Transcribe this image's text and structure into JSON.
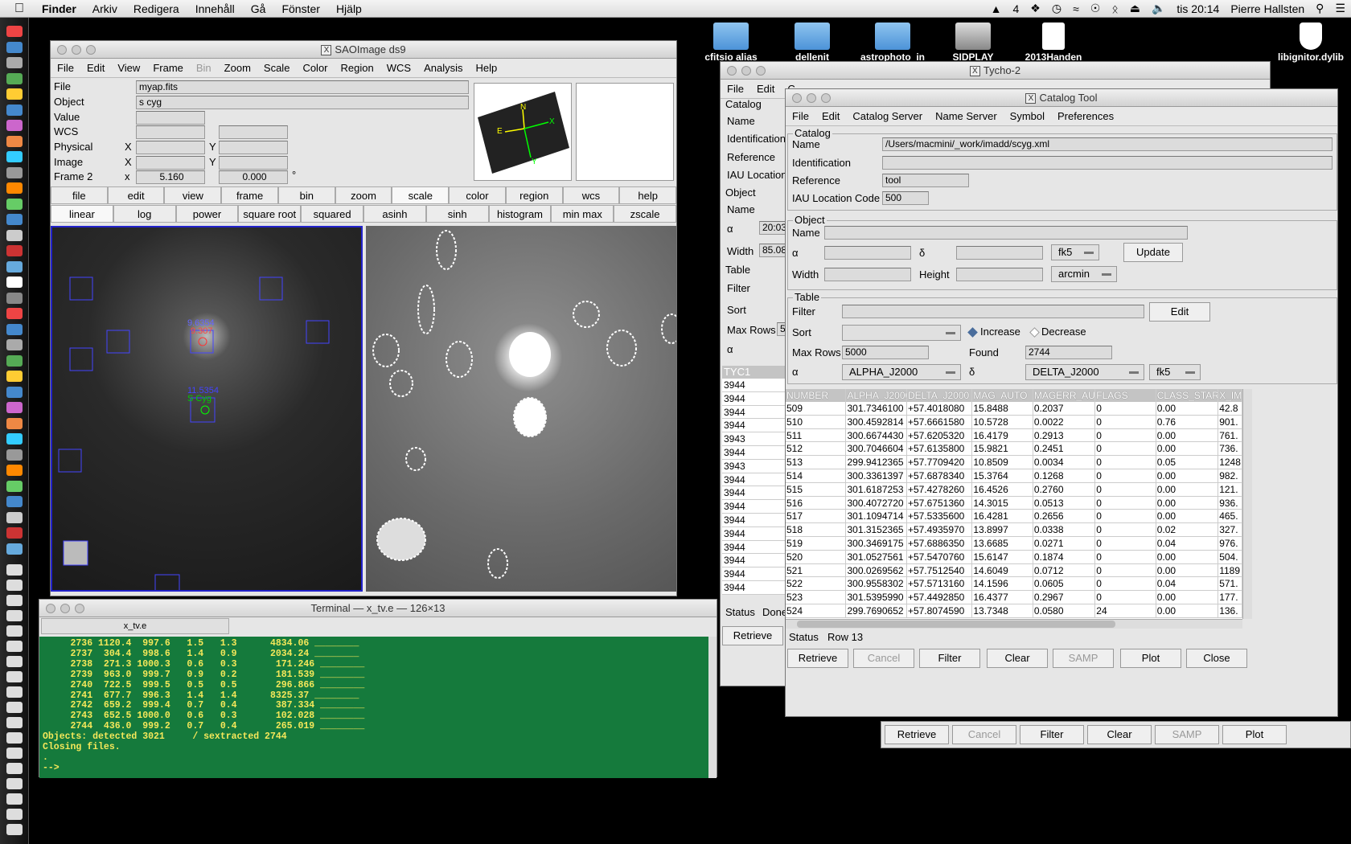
{
  "menubar": {
    "app": "Finder",
    "items": [
      "Arkiv",
      "Redigera",
      "Innehåll",
      "Gå",
      "Fönster",
      "Hjälp"
    ],
    "status": [
      "4",
      "tis 20:14",
      "Pierre Hallsten"
    ]
  },
  "desktop": {
    "icons": [
      "cfitsio alias",
      "dellenit",
      "astrophoto_in",
      "SIDPLAY",
      "2013Handen",
      "libignitor.dylib"
    ]
  },
  "ds9": {
    "title": "SAOImage ds9",
    "menu": [
      "File",
      "Edit",
      "View",
      "Frame",
      "Bin",
      "Zoom",
      "Scale",
      "Color",
      "Region",
      "WCS",
      "Analysis",
      "Help"
    ],
    "info_labels": [
      "File",
      "Object",
      "Value",
      "WCS",
      "Physical",
      "Image",
      "Frame 2"
    ],
    "file": "myap.fits",
    "object": "s cyg",
    "frame_x": "5.160",
    "frame_y": "0.000",
    "deg": "°",
    "x_label": "X",
    "y_label": "Y",
    "x_lower": "x",
    "buttons": [
      "file",
      "edit",
      "view",
      "frame",
      "bin",
      "zoom",
      "scale",
      "color",
      "region",
      "wcs",
      "help"
    ],
    "scale_buttons": [
      "linear",
      "log",
      "power",
      "square root",
      "squared",
      "asinh",
      "sinh",
      "histogram",
      "min max",
      "zscale"
    ],
    "compass": {
      "n": "N",
      "e": "E",
      "x": "X",
      "y": "Y"
    },
    "labels": {
      "a": "9.6354",
      "b": "9.307",
      "c": "11.5354",
      "d": "S Cyg"
    }
  },
  "tycho": {
    "title": "Tycho-2",
    "menu": [
      "File",
      "Edit",
      "C"
    ],
    "labels": [
      "Catalog",
      "Name",
      "Identification",
      "Reference",
      "IAU Location",
      "Object",
      "Name",
      "Width",
      "Table",
      "Filter",
      "Sort",
      "Max Rows"
    ],
    "alpha": "α",
    "alpha_val": "20:03",
    "width_val": "85.08",
    "maxrows_val": "5",
    "col": "TYC1",
    "rows": [
      "3944",
      "3944",
      "3944",
      "3944",
      "3943",
      "3944",
      "3943",
      "3944",
      "3944",
      "3944",
      "3944",
      "3944",
      "3944",
      "3944",
      "3944",
      "3944"
    ],
    "status_label": "Status",
    "status_val": "Done",
    "retrieve": "Retrieve"
  },
  "catalog": {
    "title": "Catalog Tool",
    "menu": [
      "File",
      "Edit",
      "Catalog Server",
      "Name Server",
      "Symbol",
      "Preferences"
    ],
    "catalog_section": "Catalog",
    "name_label": "Name",
    "name_val": "/Users/macmini/_work/imadd/scyg.xml",
    "ident_label": "Identification",
    "ref_label": "Reference",
    "ref_val": "tool",
    "iau_label": "IAU Location Code",
    "iau_val": "500",
    "object_section": "Object",
    "obj_name_label": "Name",
    "alpha": "α",
    "delta": "δ",
    "system": "fk5",
    "update": "Update",
    "width_label": "Width",
    "height_label": "Height",
    "unit": "arcmin",
    "table_section": "Table",
    "filter_label": "Filter",
    "edit": "Edit",
    "sort_label": "Sort",
    "increase": "Increase",
    "decrease": "Decrease",
    "maxrows_label": "Max Rows",
    "maxrows_val": "5000",
    "found_label": "Found",
    "found_val": "2744",
    "alpha_col": "ALPHA_J2000",
    "delta_col": "DELTA_J2000",
    "sys2": "fk5",
    "columns": [
      "NUMBER",
      "ALPHA_J2000",
      "DELTA_J2000",
      "MAG_AUTO",
      "MAGERR_AUTO",
      "FLAGS",
      "CLASS_STAR",
      "X_IM"
    ],
    "rows": [
      [
        "509",
        "301.7346100",
        "+57.4018080",
        "15.8488",
        "0.2037",
        "0",
        "0.00",
        "42.8"
      ],
      [
        "510",
        "300.4592814",
        "+57.6661580",
        "10.5728",
        "0.0022",
        "0",
        "0.76",
        "901."
      ],
      [
        "511",
        "300.6674430",
        "+57.6205320",
        "16.4179",
        "0.2913",
        "0",
        "0.00",
        "761."
      ],
      [
        "512",
        "300.7046604",
        "+57.6135800",
        "15.9821",
        "0.2451",
        "0",
        "0.00",
        "736."
      ],
      [
        "513",
        "299.9412365",
        "+57.7709420",
        "10.8509",
        "0.0034",
        "0",
        "0.05",
        "1248"
      ],
      [
        "514",
        "300.3361397",
        "+57.6878340",
        "15.3764",
        "0.1268",
        "0",
        "0.00",
        "982."
      ],
      [
        "515",
        "301.6187253",
        "+57.4278260",
        "16.4526",
        "0.2760",
        "0",
        "0.00",
        "121."
      ],
      [
        "516",
        "300.4072720",
        "+57.6751360",
        "14.3015",
        "0.0513",
        "0",
        "0.00",
        "936."
      ],
      [
        "517",
        "301.1094714",
        "+57.5335600",
        "16.4281",
        "0.2656",
        "0",
        "0.00",
        "465."
      ],
      [
        "518",
        "301.3152365",
        "+57.4935970",
        "13.8997",
        "0.0338",
        "0",
        "0.02",
        "327."
      ],
      [
        "519",
        "300.3469175",
        "+57.6886350",
        "13.6685",
        "0.0271",
        "0",
        "0.04",
        "976."
      ],
      [
        "520",
        "301.0527561",
        "+57.5470760",
        "15.6147",
        "0.1874",
        "0",
        "0.00",
        "504."
      ],
      [
        "521",
        "300.0269562",
        "+57.7512540",
        "14.6049",
        "0.0712",
        "0",
        "0.00",
        "1189"
      ],
      [
        "522",
        "300.9558302",
        "+57.5713160",
        "14.1596",
        "0.0605",
        "0",
        "0.04",
        "571."
      ],
      [
        "523",
        "301.5395990",
        "+57.4492850",
        "16.4377",
        "0.2967",
        "0",
        "0.00",
        "177."
      ],
      [
        "524",
        "299.7690652",
        "+57.8074590",
        "13.7348",
        "0.0580",
        "24",
        "0.00",
        "136."
      ]
    ],
    "status_label": "Status",
    "status_val": "Row 13",
    "buttons": [
      "Retrieve",
      "Cancel",
      "Filter",
      "Clear",
      "SAMP",
      "Plot",
      "Close"
    ]
  },
  "bottom_buttons": [
    "Retrieve",
    "Cancel",
    "Filter",
    "Clear",
    "SAMP",
    "Plot"
  ],
  "terminal": {
    "title": "Terminal — x_tv.e — 126×13",
    "tab": "x_tv.e",
    "lines": [
      "     2736 1120.4  997.6   1.5   1.3      4834.06 ________",
      "     2737  304.4  998.6   1.4   0.9      2034.24 ________",
      "     2738  271.3 1000.3   0.6   0.3       171.246 ________",
      "     2739  963.0  999.7   0.9   0.2       181.539 ________",
      "     2740  722.5  999.5   0.5   0.5       296.866 ________",
      "     2741  677.7  996.3   1.4   1.4      8325.37 ________",
      "     2742  659.2  999.4   0.7   0.4       387.334 ________",
      "     2743  652.5 1000.0   0.6   0.3       102.028 ________",
      "     2744  436.0  999.2   0.7   0.4       265.019 ________",
      "Objects: detected 3021     / sextracted 2744",
      "Closing files.",
      ".",
      "--> "
    ]
  }
}
